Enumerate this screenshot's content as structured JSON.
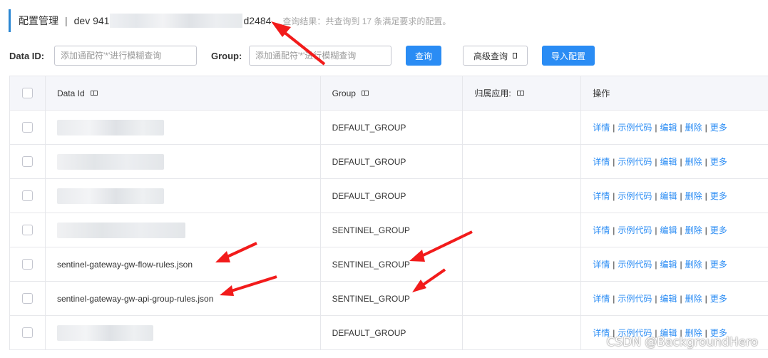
{
  "header": {
    "title": "配置管理",
    "separator": "|",
    "namespace_prefix": "dev  941",
    "namespace_suffix": "d2484",
    "result": "查询结果：共查询到 17 条满足要求的配置。"
  },
  "search": {
    "dataid_label": "Data ID:",
    "dataid_placeholder": "添加通配符'*'进行模糊查询",
    "group_label": "Group:",
    "group_placeholder": "添加通配符'*'进行模糊查询",
    "query_button": "查询",
    "advanced_button": "高级查询",
    "import_button": "导入配置"
  },
  "table": {
    "columns": [
      "Data Id",
      "Group",
      "归属应用:",
      "操作"
    ],
    "rows": [
      {
        "data_id": "",
        "group": "DEFAULT_GROUP",
        "app": ""
      },
      {
        "data_id": "",
        "group": "DEFAULT_GROUP",
        "app": ""
      },
      {
        "data_id": "",
        "group": "DEFAULT_GROUP",
        "app": ""
      },
      {
        "data_id": "",
        "group": "SENTINEL_GROUP",
        "app": ""
      },
      {
        "data_id": "sentinel-gateway-gw-flow-rules.json",
        "group": "SENTINEL_GROUP",
        "app": ""
      },
      {
        "data_id": "sentinel-gateway-gw-api-group-rules.json",
        "group": "SENTINEL_GROUP",
        "app": ""
      },
      {
        "data_id": "",
        "group": "DEFAULT_GROUP",
        "app": ""
      }
    ],
    "actions": [
      "详情",
      "示例代码",
      "编辑",
      "删除",
      "更多"
    ],
    "action_separator": "|"
  },
  "watermark": "CSDN @BackgroundHero",
  "colors": {
    "accent": "#2a8cf4",
    "header_bar": "#2b87d3",
    "annotation_arrow": "#f21b1b"
  }
}
